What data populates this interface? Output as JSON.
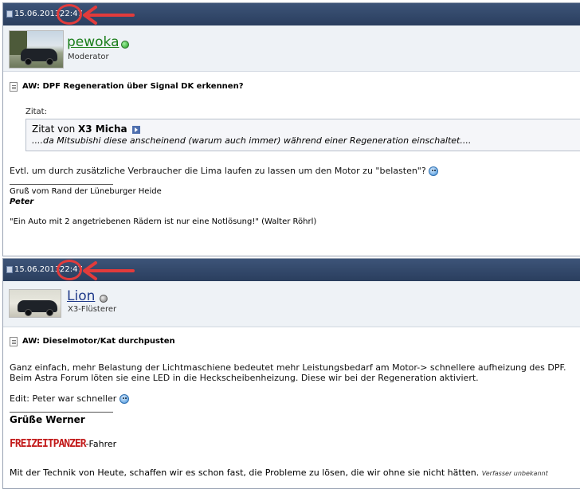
{
  "posts": [
    {
      "date": "15.06.2013,",
      "time": "22:47",
      "username": "pewoka",
      "rank": "Moderator",
      "title": "AW: DPF Regeneration über Signal DK erkennen?",
      "quote_label": "Zitat:",
      "quote_prefix": "Zitat von",
      "quote_author": "X3 Micha",
      "quote_text": "....da Mitsubishi diese anscheinend (warum auch immer) während einer Regeneration einschaltet....",
      "message": "Evtl. um durch zusätzliche Verbraucher die Lima laufen zu lassen um den Motor zu \"belasten\"?",
      "signature_line1": "Gruß vom Rand der Lüneburger Heide",
      "signature_name": "Peter",
      "signature_quote": "\"Ein Auto mit 2 angetriebenen Rädern ist nur eine Notlösung!\" (Walter Röhrl)"
    },
    {
      "date": "15.06.2013,",
      "time": "22:47",
      "username": "Lion",
      "rank": "X3-Flüsterer",
      "title": "AW: Dieselmotor/Kat durchpusten",
      "message_line1": "Ganz einfach, mehr Belastung der Lichtmaschiene bedeutet mehr Leistungsbedarf am Motor-> schnellere aufheizung des DPF.",
      "message_line2": "Beim Astra Forum löten sie eine LED in die Heckscheibenheizung. Diese wir bei der Regeneration aktiviert.",
      "edit_text": "Edit: Peter war schneller",
      "greeting": "Grüße Werner",
      "brand_logo": "FREIZEITPANZER",
      "brand_suffix": "-Fahrer",
      "motto": "Mit der Technik von Heute, schaffen wir es schon fast, die Probleme zu lösen, die wir ohne sie nicht hätten.",
      "motto_author": "Verfasser unbekannt"
    }
  ],
  "colors": {
    "header_bg": "#2f4468",
    "highlight_red": "#e23b3b",
    "online_name": "#1a7e1a",
    "offline_name": "#1f3a8a"
  },
  "icons": [
    "document-icon",
    "online-status-icon",
    "offline-status-icon",
    "post-title-icon",
    "view-post-icon",
    "smile-icon",
    "red-arrow-annotation"
  ]
}
